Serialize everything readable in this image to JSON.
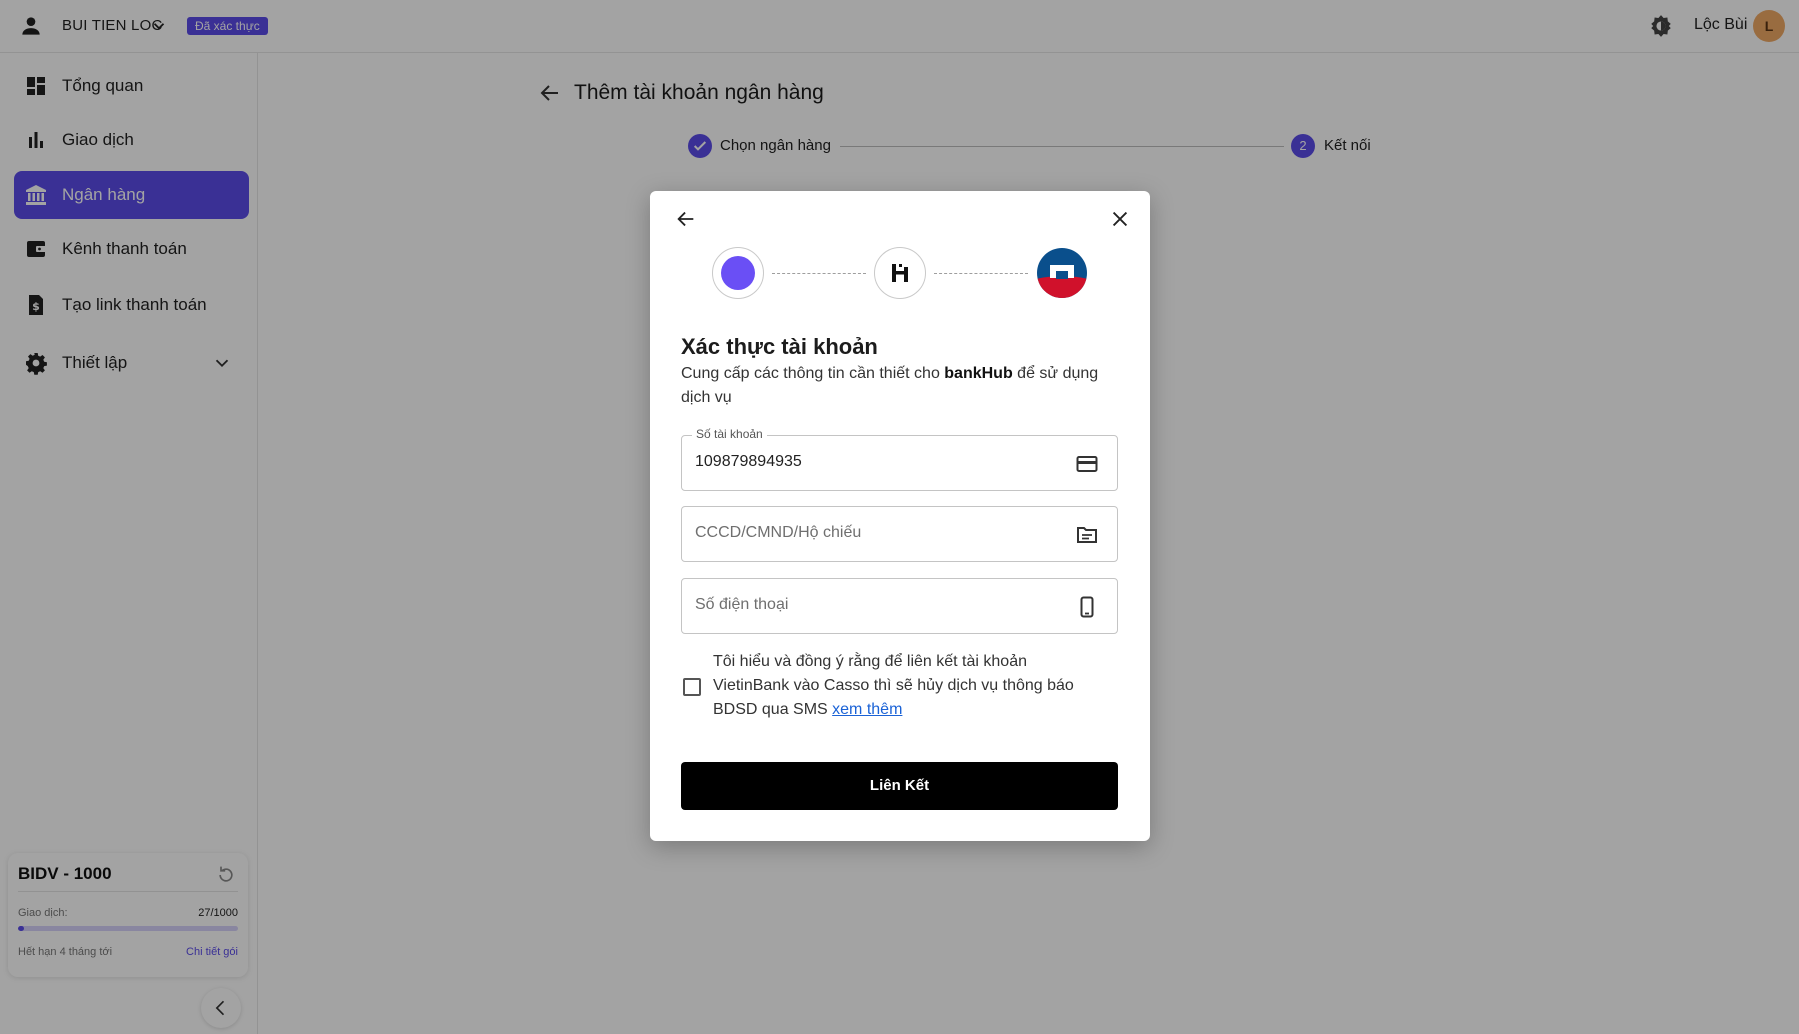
{
  "topbar": {
    "account_name": "BUI TIEN LOC",
    "verified_badge": "Đã xác thực",
    "profile_name": "Lộc Bùi",
    "avatar_initial": "L"
  },
  "sidebar": {
    "items": [
      {
        "label": "Tổng quan",
        "icon": "dashboard-icon"
      },
      {
        "label": "Giao dịch",
        "icon": "bar-chart-icon"
      },
      {
        "label": "Ngân hàng",
        "icon": "bank-icon",
        "active": true
      },
      {
        "label": "Kênh thanh toán",
        "icon": "wallet-icon"
      },
      {
        "label": "Tạo link thanh toán",
        "icon": "receipt-icon"
      },
      {
        "label": "Thiết lập",
        "icon": "gear-icon"
      }
    ],
    "plan": {
      "name": "BIDV - 1000",
      "tx_label": "Giao dịch:",
      "tx_count": "27/1000",
      "progress_fraction": 0.027,
      "expiry": "Hết hạn 4 tháng tới",
      "details_link": "Chi tiết gói"
    }
  },
  "main": {
    "title": "Thêm tài khoản ngân hàng",
    "steps": [
      {
        "label": "Chọn ngân hàng",
        "done": true
      },
      {
        "number": "2",
        "label": "Kết nối"
      }
    ]
  },
  "modal": {
    "heading": "Xác thực tài khoản",
    "desc_prefix": "Cung cấp các thông tin cần thiết cho ",
    "desc_brand": "bankHub",
    "desc_suffix": " để sử dụng dịch vụ",
    "fields": {
      "account": {
        "label": "Số tài khoản",
        "value": "109879894935",
        "icon": "credit-card-icon"
      },
      "id": {
        "placeholder": "CCCD/CMND/Hộ chiếu",
        "icon": "id-card-icon"
      },
      "phone": {
        "placeholder": "Số điện thoại",
        "icon": "phone-icon"
      }
    },
    "consent_text": "Tôi hiểu và đồng ý rằng để liên kết tài khoản VietinBank vào Casso thì sẽ hủy dịch vụ thông báo BDSD qua SMS ",
    "consent_link": "xem thêm",
    "submit_label": "Liên Kết"
  },
  "colors": {
    "accent": "#5b4bea",
    "submit_bg": "#000000",
    "link": "#1a62d6"
  }
}
